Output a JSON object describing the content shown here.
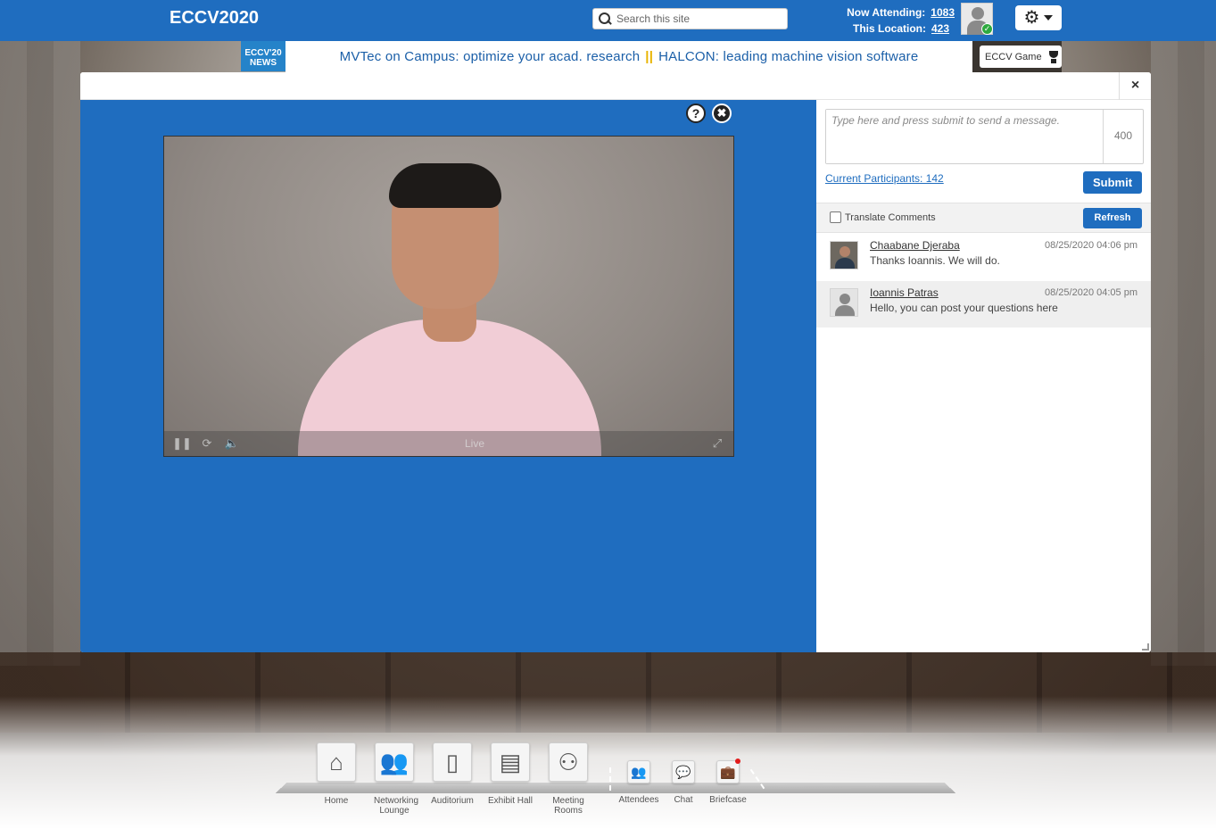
{
  "header": {
    "site_title": "ECCV2020",
    "search_placeholder": "Search this site",
    "now_attending_label": "Now Attending:",
    "now_attending_value": "1083",
    "this_location_label": "This Location:",
    "this_location_value": "423",
    "accent_color": "#1f6dbf"
  },
  "banner": {
    "news_logo_text": "ECCV'20 NEWS",
    "text_part1": "MVTec on Campus: optimize your acad. research",
    "separator": "||",
    "text_part2": "HALCON: leading machine vision software",
    "game_button_label": "ECCV Game"
  },
  "modal": {
    "close_label": "×",
    "help_label": "?",
    "video_close_label": "✖",
    "video": {
      "live_label": "Live",
      "pause_icon": "pause-icon",
      "refresh_icon": "refresh-icon",
      "volume_icon": "volume-icon",
      "fullscreen_icon": "fullscreen-icon"
    },
    "chat": {
      "message_placeholder": "Type here and press submit to send a message.",
      "char_count": "400",
      "participants_label": "Current Participants: 142",
      "submit_label": "Submit",
      "translate_label": "Translate Comments",
      "refresh_label": "Refresh",
      "comments": [
        {
          "name": "Chaabane Djeraba",
          "date": "08/25/2020 04:06 pm",
          "text": "Thanks Ioannis. We will do."
        },
        {
          "name": "Ioannis Patras",
          "date": "08/25/2020 04:05 pm",
          "text": "Hello, you can post your questions here"
        }
      ]
    }
  },
  "nav": {
    "home": "Home",
    "networking_lounge": "Networking Lounge",
    "auditorium": "Auditorium",
    "exhibit_hall": "Exhibit Hall",
    "meeting_rooms": "Meeting Rooms",
    "attendees": "Attendees",
    "chat": "Chat",
    "briefcase": "Briefcase"
  }
}
